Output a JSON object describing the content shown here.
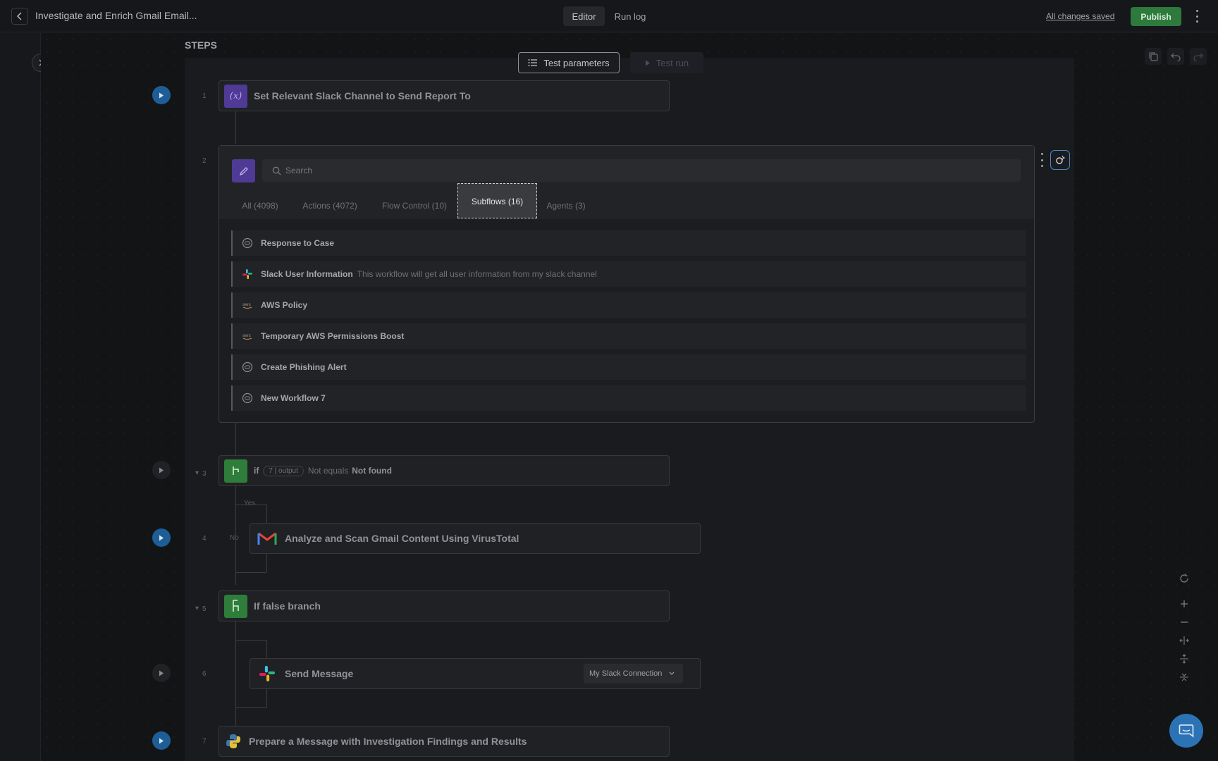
{
  "header": {
    "title": "Investigate and Enrich Gmail Email...",
    "tabs": [
      {
        "label": "Editor",
        "active": true
      },
      {
        "label": "Run log",
        "active": false
      }
    ],
    "save_status": "All changes saved",
    "publish_label": "Publish"
  },
  "canvas": {
    "steps_heading": "STEPS",
    "test_parameters_label": "Test parameters",
    "test_run_label": "Test run"
  },
  "steps": [
    {
      "number": "1",
      "title": "Set Relevant Slack Channel to Send Report To",
      "icon": "variable-icon"
    },
    {
      "number": "2"
    },
    {
      "number": "3",
      "if_label": "if",
      "pill": "7 | output",
      "operator": "Not equals",
      "value": "Not found",
      "icon": "branch-icon"
    },
    {
      "number": "4",
      "title": "Analyze and Scan Gmail Content Using VirusTotal",
      "icon": "gmail-icon"
    },
    {
      "number": "5",
      "title": "If false branch",
      "icon": "branch-icon"
    },
    {
      "number": "6",
      "title": "Send Message",
      "icon": "slack-icon",
      "connection": "My Slack Connection"
    },
    {
      "number": "7",
      "title": "Prepare a Message with Investigation Findings and Results",
      "icon": "python-icon"
    }
  ],
  "branch_labels": {
    "yes": "Yes",
    "no": "No"
  },
  "picker": {
    "search_placeholder": "Search",
    "tabs": [
      {
        "label": "All (4098)",
        "active": false
      },
      {
        "label": "Actions (4072)",
        "active": false
      },
      {
        "label": "Flow Control (10)",
        "active": false
      },
      {
        "label": "Subflows (16)",
        "active": true
      },
      {
        "label": "Agents (3)",
        "active": false
      }
    ],
    "subflows": [
      {
        "name": "Response to Case",
        "description": "",
        "icon": "bot-icon"
      },
      {
        "name": "Slack User Information",
        "description": "This workflow will get all user information from my slack channel",
        "icon": "slack-icon"
      },
      {
        "name": "AWS Policy",
        "description": "",
        "icon": "aws-icon"
      },
      {
        "name": "Temporary AWS Permissions Boost",
        "description": "",
        "icon": "aws-icon"
      },
      {
        "name": "Create Phishing Alert",
        "description": "",
        "icon": "bot-icon"
      },
      {
        "name": "New Workflow 7",
        "description": "",
        "icon": "bot-icon"
      }
    ]
  },
  "colors": {
    "publish": "#2d7a3c",
    "play_active": "#1e5e96",
    "accent_purple": "#4f3a96",
    "branch_green": "#2e7d3a"
  }
}
